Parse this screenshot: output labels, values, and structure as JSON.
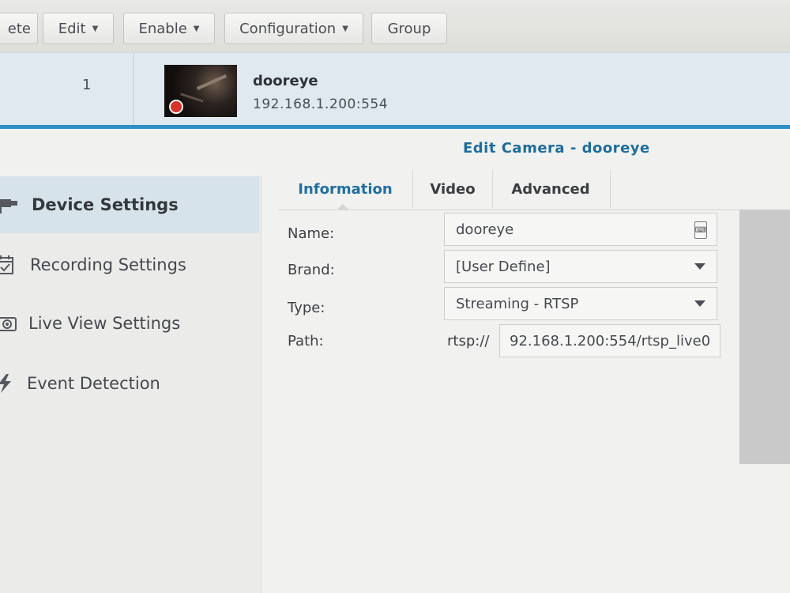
{
  "toolbar": {
    "delete_label": "ete",
    "edit_label": "Edit",
    "enable_label": "Enable",
    "configuration_label": "Configuration",
    "group_label": "Group"
  },
  "camera_row": {
    "index": "1",
    "name": "dooreye",
    "address": "192.168.1.200:554",
    "recording_indicator_color": "#d8332b"
  },
  "dialog": {
    "title": "Edit Camera - dooreye",
    "nav": [
      {
        "label": "Device Settings",
        "icon": "device-camera-icon",
        "active": true
      },
      {
        "label": "Recording Settings",
        "icon": "calendar-check-icon",
        "active": false
      },
      {
        "label": "Live View Settings",
        "icon": "live-view-camera-icon",
        "active": false
      },
      {
        "label": "Event Detection",
        "icon": "lightning-icon",
        "active": false
      }
    ],
    "tabs": [
      {
        "label": "Information",
        "active": true
      },
      {
        "label": "Video",
        "active": false
      },
      {
        "label": "Advanced",
        "active": false
      }
    ],
    "form": {
      "name_label": "Name:",
      "name_value": "dooreye",
      "brand_label": "Brand:",
      "brand_value": "[User Define]",
      "type_label": "Type:",
      "type_value": "Streaming - RTSP",
      "path_label": "Path:",
      "path_prefix": "rtsp://",
      "path_value": "92.168.1.200:554/rtsp_live0"
    }
  },
  "colors": {
    "accent": "#2e8fc7",
    "title_blue": "#1e6d9b",
    "active_nav_bg": "#d6e3ea"
  }
}
